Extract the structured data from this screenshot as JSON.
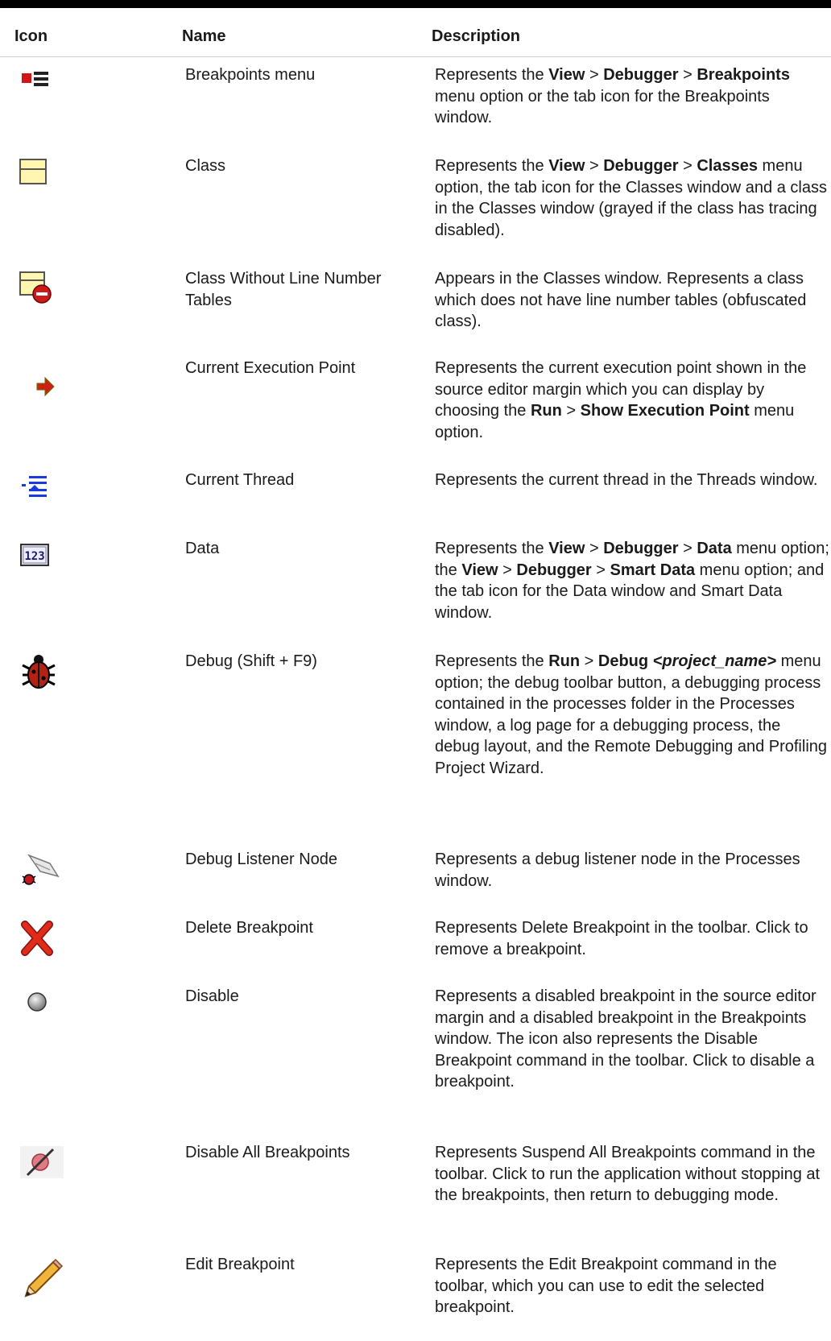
{
  "table": {
    "headers": {
      "icon": "Icon",
      "name": "Name",
      "description": "Description"
    },
    "rows": [
      {
        "icon": "breakpoints-menu-icon",
        "name": "Breakpoints menu",
        "description": [
          "Represents the ",
          {
            "b": "View"
          },
          " > ",
          {
            "b": "Debugger"
          },
          " > ",
          {
            "b": "Breakpoints"
          },
          " menu option or the tab icon for the Breakpoints window."
        ]
      },
      {
        "icon": "class-icon",
        "name": "Class",
        "description": [
          "Represents the ",
          {
            "b": "View"
          },
          " > ",
          {
            "b": "Debugger"
          },
          " > ",
          {
            "b": "Classes"
          },
          " menu option, the tab icon for the Classes window and a class in the Classes window (grayed if the class has tracing disabled)."
        ]
      },
      {
        "icon": "class-no-line-numbers-icon",
        "name": "Class Without Line Number Tables",
        "description": [
          "Appears in the Classes window. Represents a class which does not have line number tables (obfuscated class)."
        ]
      },
      {
        "icon": "execution-point-icon",
        "name": "Current Execution Point",
        "description": [
          "Represents the current execution point shown in the source editor margin which you can display by choosing the ",
          {
            "b": "Run"
          },
          " > ",
          {
            "b": "Show Execution Point"
          },
          " menu option."
        ]
      },
      {
        "icon": "current-thread-icon",
        "name": "Current Thread",
        "description": [
          "Represents the current thread in the Threads window."
        ]
      },
      {
        "icon": "data-icon",
        "name": "Data",
        "description": [
          "Represents the ",
          {
            "b": "View"
          },
          " > ",
          {
            "b": "Debugger"
          },
          " > ",
          {
            "b": "Data"
          },
          " menu option; the ",
          {
            "b": "View"
          },
          " > ",
          {
            "b": "Debugger"
          },
          " > ",
          {
            "b": "Smart Data"
          },
          " menu option; and the tab icon for the Data window and Smart Data window."
        ]
      },
      {
        "icon": "debug-bug-icon",
        "name": "Debug (Shift + F9)",
        "description": [
          "Represents the ",
          {
            "b": "Run"
          },
          " > ",
          {
            "b": "Debug"
          },
          " ",
          {
            "bi": "<project_name>"
          },
          " menu option; the debug toolbar button, a debugging process contained in the processes folder in the Processes window, a log page for a debugging process, the debug layout, and the Remote Debugging and Profiling Project Wizard."
        ]
      },
      {
        "icon": "debug-listener-node-icon",
        "name": "Debug Listener Node",
        "description": [
          "Represents a debug listener node in the Processes window."
        ]
      },
      {
        "icon": "delete-breakpoint-icon",
        "name": "Delete Breakpoint",
        "description": [
          "Represents Delete Breakpoint in the toolbar. Click to remove a breakpoint."
        ]
      },
      {
        "icon": "disabled-breakpoint-icon",
        "name": "Disable",
        "description": [
          "Represents a disabled breakpoint in the source editor margin and a disabled breakpoint in the Breakpoints window. The icon also represents the Disable Breakpoint command in the toolbar. Click to disable a breakpoint."
        ]
      },
      {
        "icon": "disable-all-breakpoints-icon",
        "name": "Disable All Breakpoints",
        "description": [
          "Represents Suspend All Breakpoints command in the toolbar. Click to run the application without stopping at the breakpoints, then return to debugging mode."
        ]
      },
      {
        "icon": "edit-breakpoint-pencil-icon",
        "name": "Edit Breakpoint",
        "description": [
          "Represents the Edit Breakpoint command in the toolbar, which you can use to edit the selected breakpoint."
        ]
      }
    ]
  }
}
